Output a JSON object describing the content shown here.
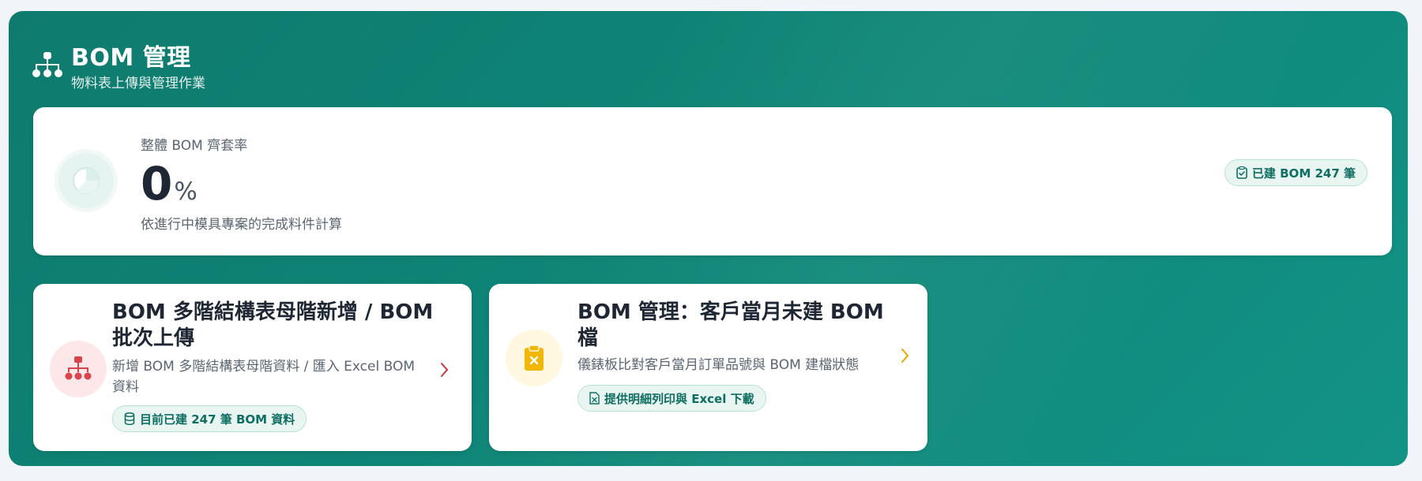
{
  "header": {
    "title": "BOM 管理",
    "subtitle": "物料表上傳與管理作業",
    "icon": "sitemap-icon"
  },
  "rate": {
    "label": "整體 BOM 齊套率",
    "value": "0",
    "unit": "%",
    "note": "依進行中模具專案的完成料件計算",
    "icon": "pie-chart-icon",
    "built_badge": "已建 BOM 247 筆",
    "built_badge_icon": "clipboard-check-icon"
  },
  "cards": [
    {
      "title": "BOM 多階結構表母階新增 / BOM 批次上傳",
      "description": "新增 BOM 多階結構表母階資料 / 匯入 Excel BOM 資料",
      "badge": "目前已建 247 筆 BOM 資料",
      "icon": "sitemap-icon",
      "badge_icon": "database-icon",
      "accent": "#d9434a"
    },
    {
      "title": "BOM 管理：客戶當月未建 BOM 檔",
      "description": "儀錶板比對客戶當月訂單品號與 BOM 建檔狀態",
      "badge": "提供明細列印與 Excel 下載",
      "icon": "clipboard-x-icon",
      "badge_icon": "file-excel-icon",
      "accent": "#f2b705"
    }
  ],
  "colors": {
    "panel": "#0f7b6f",
    "accent_green": "#0f6e62"
  }
}
